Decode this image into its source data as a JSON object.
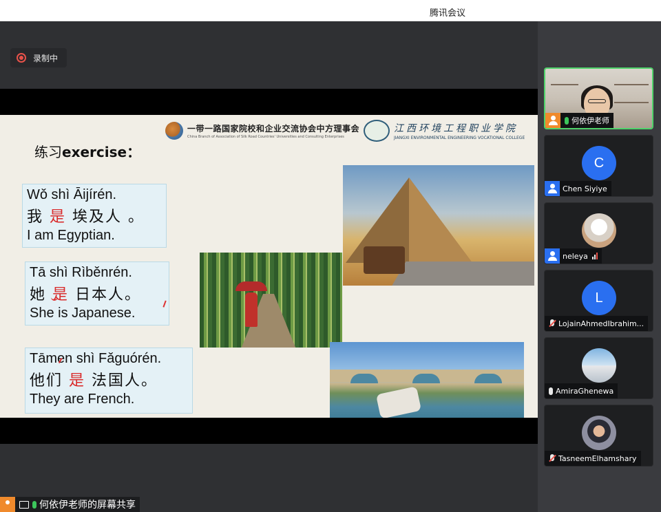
{
  "window": {
    "title": "腾讯会议"
  },
  "recording": {
    "label": "录制中",
    "color": "#e8524a"
  },
  "slide": {
    "logo1_cn": "一带一路国家院校和企业交流协会中方理事会",
    "logo1_en": "China Branch of Association of Silk Road Countries' Universities and Consulting Enterprises",
    "logo2_cn": "江西环境工程职业学院",
    "logo2_en": "JIANGXI ENVIRONMENTAL ENGINEERING VOCATIONAL COLLEGE",
    "exercise_cn": "练习",
    "exercise_en": "exercise：",
    "cards": [
      {
        "pinyin": "Wǒ shì   Āijírén.",
        "cn_a": "我",
        "cn_red": "是",
        "cn_b": "埃及人 。",
        "en": "I am Egyptian."
      },
      {
        "pinyin": "Tā shì Rìběnrén.",
        "cn_a": "她",
        "cn_red": "是",
        "cn_b": "日本人。",
        "en": "She is Japanese."
      },
      {
        "pinyin": "Tāmen shì  Fǎguórén.",
        "cn_a": "他们",
        "cn_red": "是",
        "cn_b": "法国人。",
        "en": "They   are    French."
      }
    ]
  },
  "share_label": {
    "text": "何依伊老师的屏幕共享"
  },
  "participants": [
    {
      "name": "何依伊老师",
      "type": "video",
      "audio": "on",
      "active": true
    },
    {
      "name": "Chen Siyiye",
      "type": "letter",
      "letter": "C",
      "audio": "none"
    },
    {
      "name": "neleya",
      "type": "image",
      "audio": "signal"
    },
    {
      "name": "LojainAhmedIbrahim...",
      "type": "letter",
      "letter": "L",
      "audio": "muted"
    },
    {
      "name": "AmiraGhenewa",
      "type": "image",
      "audio": "muted-plain"
    },
    {
      "name": "TasneemElhamshary",
      "type": "image",
      "audio": "muted"
    }
  ],
  "colors": {
    "accent_blue": "#2a6ff0",
    "accent_orange": "#f08a2c",
    "mic_green": "#3cc65b",
    "active_border": "#4fd36a"
  }
}
